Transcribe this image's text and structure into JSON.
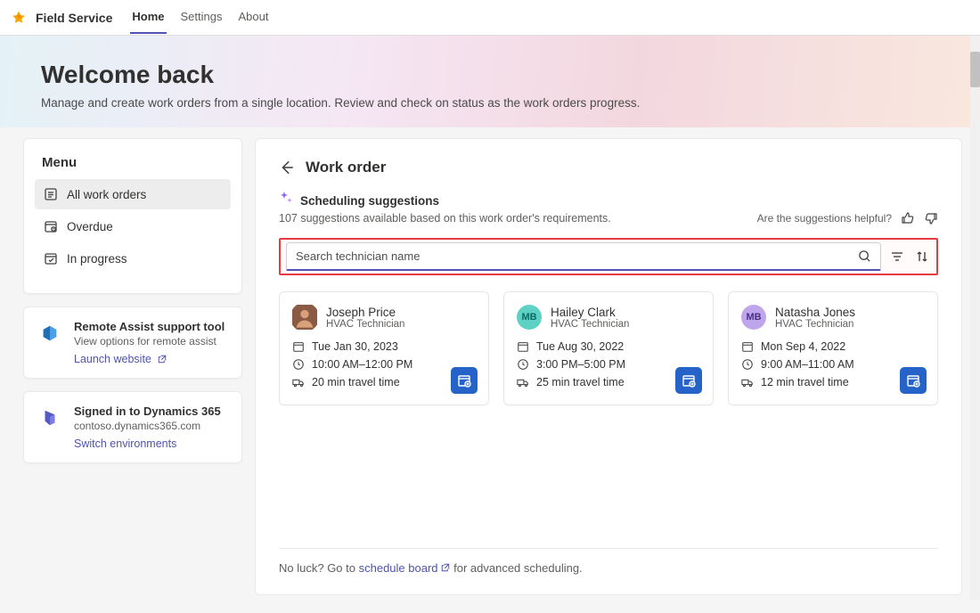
{
  "app": {
    "title": "Field Service",
    "nav": [
      "Home",
      "Settings",
      "About"
    ],
    "activeNav": 0
  },
  "banner": {
    "heading": "Welcome back",
    "sub": "Manage and create work orders from a single location. Review and check on status as the work orders progress."
  },
  "menu": {
    "title": "Menu",
    "items": [
      {
        "label": "All work orders",
        "icon": "list-icon",
        "selected": true
      },
      {
        "label": "Overdue",
        "icon": "overdue-icon",
        "selected": false
      },
      {
        "label": "In progress",
        "icon": "progress-icon",
        "selected": false
      }
    ]
  },
  "tools": [
    {
      "icon": "remote-assist-icon",
      "iconBg": "#e6f0fa",
      "title": "Remote Assist support tool",
      "sub": "View options for remote assist",
      "link": "Launch website"
    },
    {
      "icon": "dynamics-icon",
      "iconBg": "#ece9fb",
      "title": "Signed in to Dynamics 365",
      "sub": "contoso.dynamics365.com",
      "link": "Switch environments"
    }
  ],
  "workorder": {
    "title": "Work order",
    "suggestions": {
      "label": "Scheduling suggestions",
      "count_text": "107 suggestions available based on this work order's requirements.",
      "feedback_label": "Are the suggestions helpful?"
    },
    "search_placeholder": "Search technician name",
    "technicians": [
      {
        "name": "Joseph Price",
        "role": "HVAC Technician",
        "avatar_bg": "#8a5a44",
        "avatar_text": "",
        "avatar_photo": true,
        "date": "Tue Jan 30, 2023",
        "time": "10:00 AM–12:00 PM",
        "travel": "20 min travel time"
      },
      {
        "name": "Hailey Clark",
        "role": "HVAC Technician",
        "avatar_bg": "#5ed1c5",
        "avatar_text": "MB",
        "avatar_photo": false,
        "date": "Tue Aug 30, 2022",
        "time": "3:00 PM–5:00 PM",
        "travel": "25 min travel time"
      },
      {
        "name": "Natasha Jones",
        "role": "HVAC Technician",
        "avatar_bg": "#bfa6ec",
        "avatar_text": "MB",
        "avatar_photo": false,
        "date": "Mon Sep 4, 2022",
        "time": "9:00 AM–11:00 AM",
        "travel": "12 min travel time"
      }
    ],
    "footer": {
      "prefix": "No luck? Go to ",
      "link": "schedule board",
      "suffix": " for advanced scheduling."
    }
  }
}
